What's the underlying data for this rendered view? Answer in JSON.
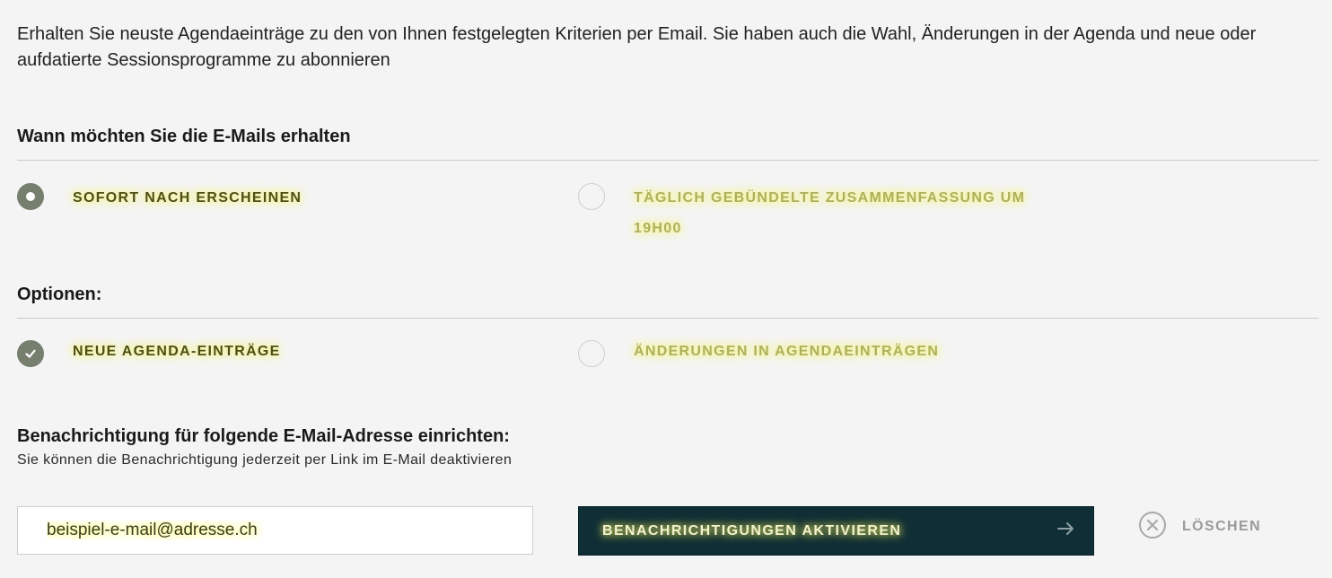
{
  "intro": "Erhalten Sie neuste Agendaeinträge zu den von Ihnen festgelegten Kriterien per Email. Sie haben auch die Wahl, Änderungen in der Agenda und neue oder aufdatierte Sessionsprogramme zu abonnieren",
  "frequency": {
    "title": "Wann möchten Sie die E-Mails erhalten",
    "options": [
      {
        "label": "SOFORT NACH ERSCHEINEN",
        "selected": true
      },
      {
        "label": "TÄGLICH GEBÜNDELTE ZUSAMMENFASSUNG UM 19H00",
        "selected": false
      }
    ]
  },
  "options": {
    "title": "Optionen:",
    "items": [
      {
        "label": "NEUE AGENDA-EINTRÄGE",
        "checked": true
      },
      {
        "label": "ÄNDERUNGEN IN AGENDAEINTRÄGEN",
        "checked": false
      }
    ]
  },
  "email": {
    "title": "Benachrichtigung für folgende E-Mail-Adresse einrichten:",
    "hint": "Sie können die Benachrichtigung jederzeit per Link im E-Mail deaktivieren",
    "value": "beispiel-e-mail@adresse.ch"
  },
  "actions": {
    "submit_label": "BENACHRICHTIGUNGEN AKTIVIEREN",
    "submit_icon": "arrow-right-icon",
    "clear_label": "LÖSCHEN",
    "clear_icon": "close-circle-icon"
  },
  "colors": {
    "background": "#f4f4f4",
    "radio_selected": "#767e6e",
    "button_bg": "#0f2e36",
    "highlight": "#f6f77a"
  }
}
